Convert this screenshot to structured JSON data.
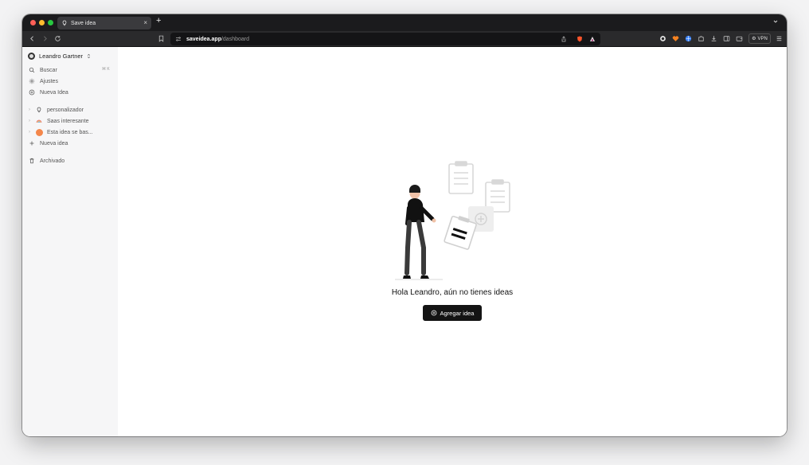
{
  "browser": {
    "tab_title": "Save idea",
    "tab_close": "×",
    "new_tab": "+",
    "url_host": "saveidea.app",
    "url_path": "/dashboard",
    "vpn_label": "VPN"
  },
  "sidebar": {
    "user_name": "Leandro Gartner",
    "search_label": "Buscar",
    "search_shortcut": "⌘ K",
    "settings_label": "Ajustes",
    "new_idea_label": "Nueva Idea",
    "ideas": [
      {
        "label": "personalizador",
        "icon": "lightbulb-icon"
      },
      {
        "label": "Saas interesante",
        "icon": "rainbow-icon"
      },
      {
        "label": "Esta idea se bas...",
        "icon": "orange-avatar-icon"
      }
    ],
    "add_idea_label": "Nueva idea",
    "archived_label": "Archivado"
  },
  "main": {
    "empty_message": "Hola Leandro, aún no tienes ideas",
    "cta_label": "Agregar idea"
  },
  "colors": {
    "accent": "#141414",
    "sidebar_bg": "#f6f6f7",
    "tabbar_bg": "#1b1b1d"
  }
}
